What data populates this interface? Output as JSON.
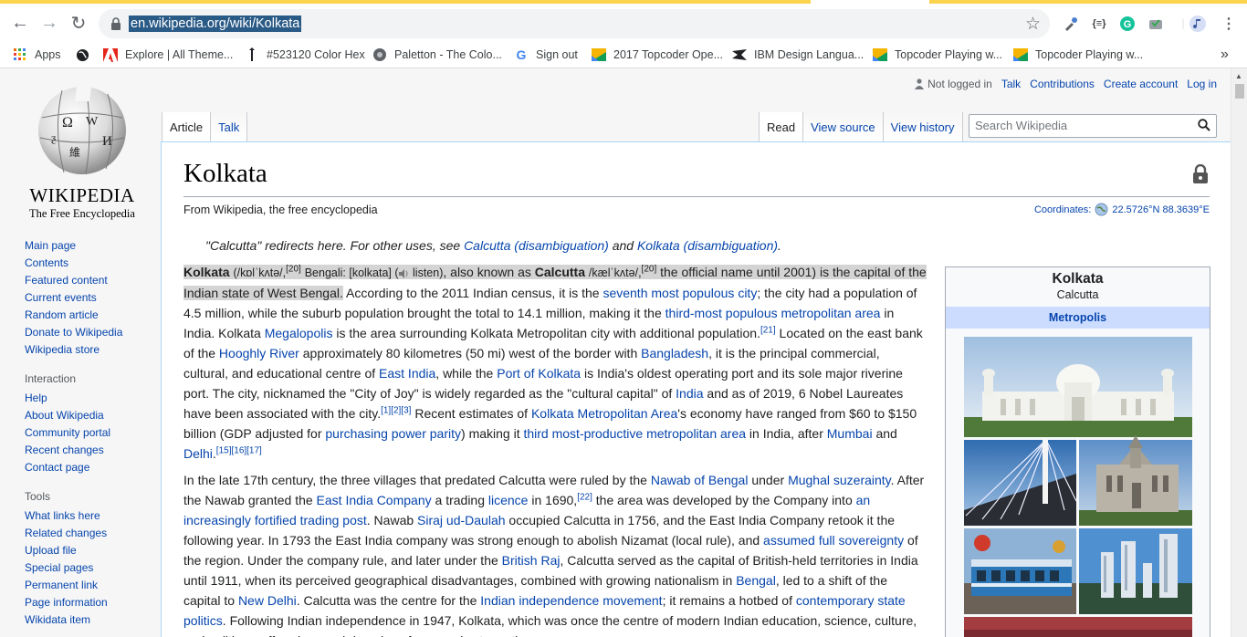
{
  "browser": {
    "url": "en.wikipedia.org/wiki/Kolkata",
    "bookmarks": [
      {
        "label": "Apps",
        "icon": "apps-grid-icon"
      },
      {
        "label": "",
        "icon": "globe-icon"
      },
      {
        "label": "Explore | All Theme...",
        "icon": "adobe-icon"
      },
      {
        "label": "#523120 Color Hex",
        "icon": "color-drop-icon"
      },
      {
        "label": "Paletton - The Colo...",
        "icon": "paletton-icon"
      },
      {
        "label": "Sign out",
        "icon": "google-icon"
      },
      {
        "label": "2017 Topcoder Ope...",
        "icon": "topcoder-icon"
      },
      {
        "label": "IBM Design Langua...",
        "icon": "ibm-icon"
      },
      {
        "label": "Topcoder Playing w...",
        "icon": "topcoder-icon"
      },
      {
        "label": "Topcoder Playing w...",
        "icon": "topcoder-icon"
      }
    ],
    "more_bookmarks": "»",
    "colors": {
      "accent_yellow": "#fbd34d",
      "url_highlight": "#2a5a86"
    }
  },
  "wiki": {
    "wordmark": "WIKIPEDIA",
    "tagline": "The Free Encyclopedia",
    "nav_main": [
      "Main page",
      "Contents",
      "Featured content",
      "Current events",
      "Random article",
      "Donate to Wikipedia",
      "Wikipedia store"
    ],
    "nav_interaction_heading": "Interaction",
    "nav_interaction": [
      "Help",
      "About Wikipedia",
      "Community portal",
      "Recent changes",
      "Contact page"
    ],
    "nav_tools_heading": "Tools",
    "nav_tools": [
      "What links here",
      "Related changes",
      "Upload file",
      "Special pages",
      "Permanent link",
      "Page information",
      "Wikidata item"
    ],
    "personal": {
      "not_logged_in": "Not logged in",
      "talk": "Talk",
      "contributions": "Contributions",
      "create_account": "Create account",
      "login": "Log in"
    },
    "tabs_left": [
      "Article",
      "Talk"
    ],
    "tabs_right": [
      "Read",
      "View source",
      "View history"
    ],
    "search_placeholder": "Search Wikipedia",
    "title": "Kolkata",
    "from": "From Wikipedia, the free encyclopedia",
    "coords_label": "Coordinates:",
    "coords_value": "22.5726°N 88.3639°E",
    "hatnote": {
      "pre": "\"Calcutta\" redirects here. For other uses, see ",
      "link1": "Calcutta (disambiguation)",
      "mid": " and ",
      "link2": "Kolkata (disambiguation)",
      "post": "."
    },
    "infobox": {
      "title": "Kolkata",
      "subtitle": "Calcutta",
      "header": "Metropolis"
    }
  }
}
